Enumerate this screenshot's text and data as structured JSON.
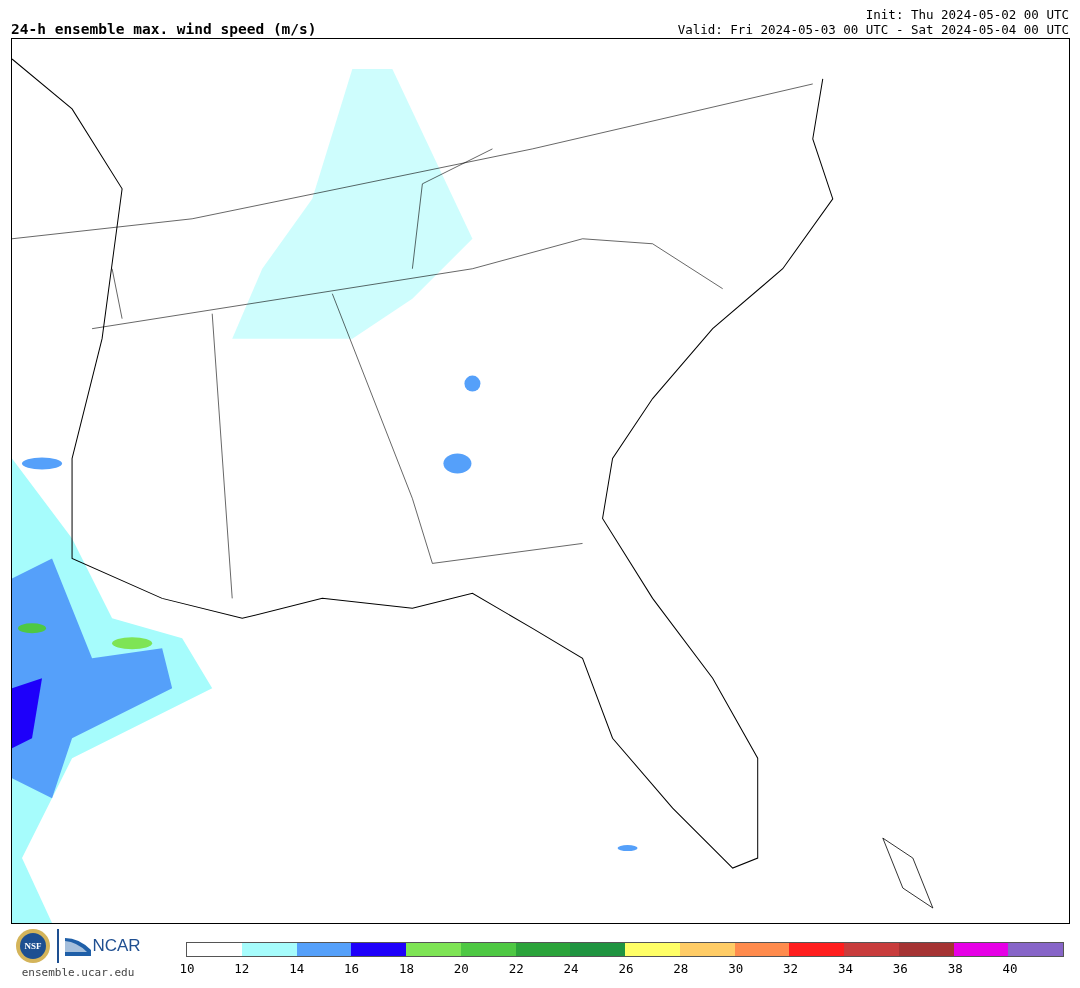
{
  "header": {
    "title": "24-h ensemble max. wind speed (m/s)",
    "init": "Init: Thu 2024-05-02 00 UTC",
    "valid": "Valid: Fri 2024-05-03 00 UTC - Sat 2024-05-04 00 UTC"
  },
  "footer": {
    "nsf_logo": "NSF",
    "ncar_logo": "NCAR",
    "url": "ensemble.ucar.edu"
  },
  "colorbar": {
    "bins": [
      {
        "color": "#ffffff"
      },
      {
        "color": "#a6fcfc"
      },
      {
        "color": "#55a0fa"
      },
      {
        "color": "#1e00fa"
      },
      {
        "color": "#7ee455"
      },
      {
        "color": "#4ec843"
      },
      {
        "color": "#2ba33a"
      },
      {
        "color": "#1f9440"
      },
      {
        "color": "#ffff66"
      },
      {
        "color": "#ffcc66"
      },
      {
        "color": "#ff8b4d"
      },
      {
        "color": "#ff1e1e"
      },
      {
        "color": "#c83c3c"
      },
      {
        "color": "#a53333"
      },
      {
        "color": "#e600e6"
      },
      {
        "color": "#8765c8"
      }
    ],
    "ticks": [
      "10",
      "12",
      "14",
      "16",
      "18",
      "20",
      "22",
      "24",
      "26",
      "28",
      "30",
      "32",
      "34",
      "36",
      "38",
      "40"
    ]
  }
}
